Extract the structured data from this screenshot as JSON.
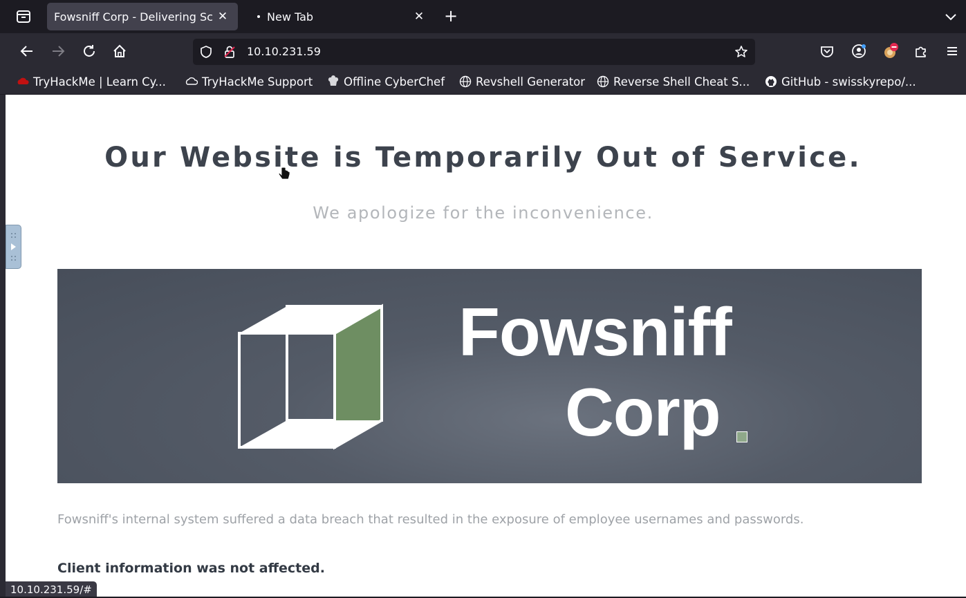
{
  "browser": {
    "tabs": [
      {
        "title": "Fowsniff Corp - Delivering Sc",
        "close": "✕",
        "active": true
      },
      {
        "title": "New Tab",
        "close": "✕",
        "active": false
      }
    ],
    "new_tab": "+",
    "url": "10.10.231.59",
    "status_url": "10.10.231.59/#",
    "bookmarks": [
      {
        "label": "TryHackMe | Learn Cy...",
        "icon": "tryhackme-icon"
      },
      {
        "label": "TryHackMe Support",
        "icon": "cloud-icon"
      },
      {
        "label": "Offline CyberChef",
        "icon": "chef-icon"
      },
      {
        "label": "Revshell Generator",
        "icon": "globe-icon"
      },
      {
        "label": "Reverse Shell Cheat S...",
        "icon": "globe-icon"
      },
      {
        "label": "GitHub - swisskyrepo/...",
        "icon": "github-icon"
      }
    ],
    "colors": {
      "toolbar": "#2b2a33",
      "tabstrip": "#1c1b22",
      "active_tab": "#42414d"
    }
  },
  "page": {
    "headline": "Our Website is Temporarily Out of Service.",
    "subheadline": "We apologize for the inconvenience.",
    "banner": {
      "name_line1": "Fowsniff",
      "name_line2": "Corp",
      "accent_color": "#8fa88a"
    },
    "paragraph": "Fowsniff's internal system suffered a data breach that resulted in the exposure of employee usernames and passwords.",
    "bold_note": "Client information was not affected."
  }
}
